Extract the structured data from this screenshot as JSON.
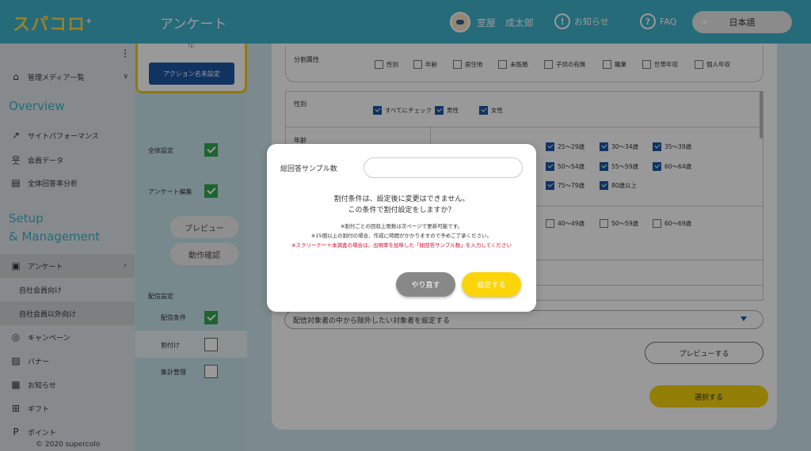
{
  "header": {
    "logo": "スパコロ",
    "logo_plus": "+",
    "page_title": "アンケート",
    "user_name": "室屋　成太郎",
    "notice_label": "お知らせ",
    "faq_label": "FAQ",
    "language": "日本語",
    "colors": {
      "bar": "#3fb3cc",
      "logo": "#ffd54a"
    }
  },
  "sidebar": {
    "media_label": "管理メディア一覧",
    "overview_title": "Overview",
    "overview_items": [
      {
        "label": "サイトパフォーマンス",
        "icon": "trend-icon"
      },
      {
        "label": "会員データ",
        "icon": "members-icon"
      },
      {
        "label": "全体回答率分析",
        "icon": "analysis-icon"
      }
    ],
    "setup_title_1": "Setup",
    "setup_title_2": "& Management",
    "survey_label": "アンケート",
    "sub_items": [
      "自社会員向け",
      "自社会員以外向け"
    ],
    "bottom_items": [
      {
        "label": "キャンペーン",
        "icon": "campaign-icon"
      },
      {
        "label": "バナー",
        "icon": "banner-icon"
      },
      {
        "label": "お知らせ",
        "icon": "news-icon"
      },
      {
        "label": "ギフト",
        "icon": "gift-icon"
      },
      {
        "label": "ポイント",
        "icon": "point-icon"
      }
    ],
    "copyright": "© 2020 supercolo"
  },
  "left_panel": {
    "fp": "fp",
    "action_button": "アクション名未設定",
    "overall_setting": "全体設定",
    "survey_edit": "アンケート編集",
    "preview_button": "プレビュー",
    "check_button": "動作確認",
    "delivery_setting": "配信設定",
    "delivery_condition": "配信条件",
    "allocation": "割付け",
    "aggregation": "集計管理"
  },
  "main": {
    "attr_title": "分割属性",
    "attr_options": [
      "性別",
      "年齢",
      "居住地",
      "未既婚",
      "子供の有無",
      "職業",
      "世帯年収",
      "個人年収"
    ],
    "gender_label": "性別",
    "gender_options": [
      "すべてにチェック",
      "男性",
      "女性"
    ],
    "age_label": "年齢",
    "age_options_row1": [
      "25～29歳",
      "30～34歳",
      "35～39歳"
    ],
    "age_options_row2": [
      "50～54歳",
      "55～59歳",
      "60～64歳"
    ],
    "age_options_row3": [
      "75～79歳",
      "80歳以上"
    ],
    "age_options_row4": [
      "40～49歳",
      "50～59歳",
      "60～69歳"
    ],
    "exclude_label": "配信対象者の中から除外したい対象者を設定する",
    "preview_button": "プレビューする",
    "select_button": "選択する"
  },
  "modal": {
    "sample_label": "総回答サンプル数",
    "sample_value": "",
    "message_1": "割付条件は、設定後に変更はできません。",
    "message_2": "この条件で割付設定をしますか？",
    "note_1": "※割付ごとの回収上限数は次ページで更新可能です。",
    "note_2": "※15個以上の割付の場合、作成に時間がかかりますので予めご了承ください。",
    "note_3": "※スクリーナー＋本調査の場合は、出現率を加味した「総回答サンプル数」を入力してください",
    "retry_button": "やり直す",
    "set_button": "設定する"
  }
}
